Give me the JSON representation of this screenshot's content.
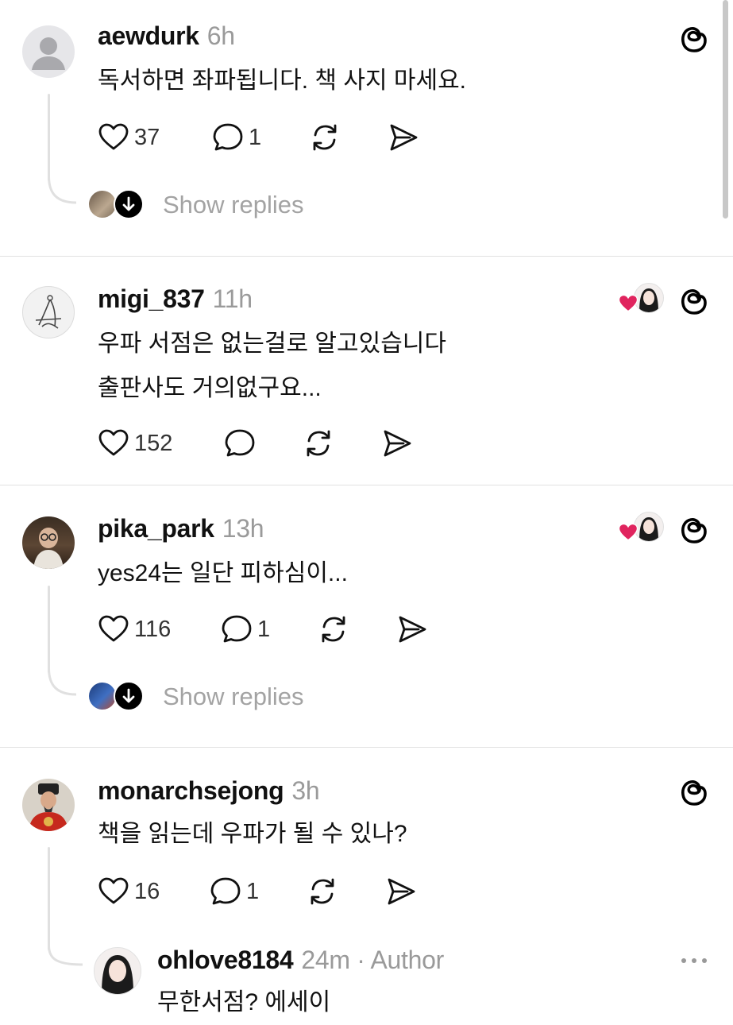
{
  "scroll": {},
  "posts": [
    {
      "username": "aewdurk",
      "time": "6h",
      "lines": [
        "독서하면 좌파됩니다. 책 사지 마세요."
      ],
      "likes": "37",
      "replies": "1",
      "show_replies": "Show replies",
      "avatar": "default-person"
    },
    {
      "username": "migi_837",
      "time": "11h",
      "lines": [
        "우파 서점은 없는걸로 알고있습니다",
        "출판사도 거의없구요..."
      ],
      "likes": "152",
      "replies": "",
      "avatar": "sketch"
    },
    {
      "username": "pika_park",
      "time": "13h",
      "lines": [
        "yes24는 일단 피하심이..."
      ],
      "likes": "116",
      "replies": "1",
      "show_replies": "Show replies",
      "avatar": "man-glasses"
    },
    {
      "username": "monarchsejong",
      "time": "3h",
      "lines": [
        "책을 읽는데 우파가 될 수 있나?"
      ],
      "likes": "16",
      "replies": "1",
      "avatar": "king-portrait"
    }
  ],
  "reply": {
    "username": "ohlove8184",
    "meta": "24m · Author",
    "line": "무한서점? 에세이"
  },
  "icons": {
    "like": "heart-icon",
    "comment": "comment-bubble-icon",
    "repost": "repost-icon",
    "share": "send-icon",
    "threads": "threads-logo-icon",
    "more": "more-dots-icon"
  },
  "colors": {
    "liked_heart": "#e0245e",
    "secondary_text": "#9a9a9a",
    "divider": "#e2e2e2"
  }
}
